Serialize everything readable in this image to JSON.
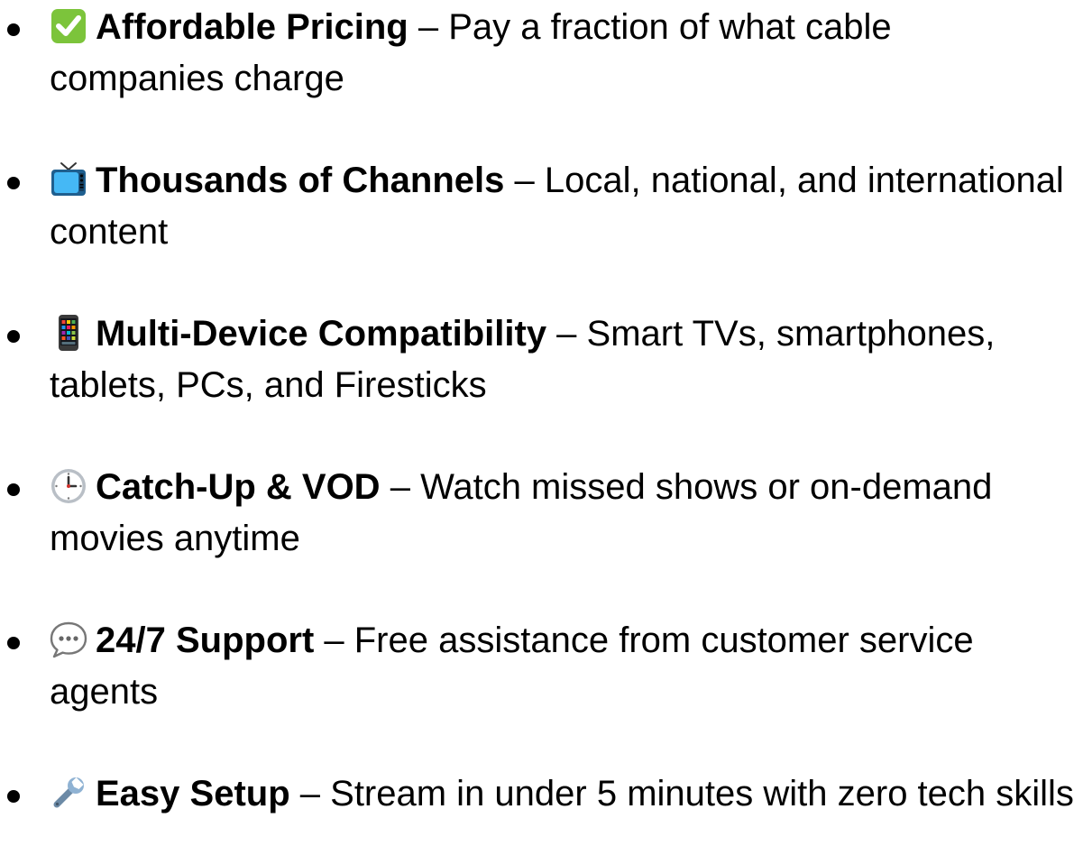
{
  "features": [
    {
      "icon": "check-mark-button-icon",
      "title": "Affordable Pricing",
      "separator": " – ",
      "description": "Pay a fraction of what cable companies charge"
    },
    {
      "icon": "television-icon",
      "title": "Thousands of Channels",
      "separator": " – ",
      "description": "Local, national, and international content"
    },
    {
      "icon": "mobile-phone-icon",
      "title": "Multi-Device Compatibility",
      "separator": " – ",
      "description": "Smart TVs, smartphones, tablets, PCs, and Firesticks"
    },
    {
      "icon": "clock-icon",
      "title": "Catch-Up & VOD",
      "separator": " – ",
      "description": "Watch missed shows or on-demand movies anytime"
    },
    {
      "icon": "speech-balloon-icon",
      "title": "24/7 Support",
      "separator": " – ",
      "description": "Free assistance from customer service agents"
    },
    {
      "icon": "wrench-icon",
      "title": "Easy Setup",
      "separator": " – ",
      "description": "Stream in under 5 minutes with zero tech skills"
    }
  ]
}
